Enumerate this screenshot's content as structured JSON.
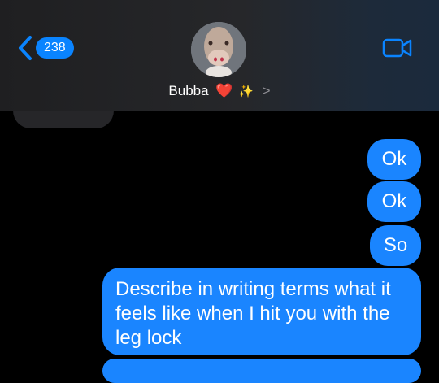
{
  "header": {
    "unread_count": "238",
    "contact_name": "Bubba",
    "heart_emoji": "❤️",
    "sparkle_emoji": "✨",
    "chevron": ">"
  },
  "messages": {
    "received_partial": "WE DO",
    "sent": [
      "Ok",
      "Ok",
      "So",
      "Describe in writing terms what it feels like when I hit you with the leg lock"
    ]
  },
  "colors": {
    "sent_bubble": "#1a85ff",
    "received_bubble": "#262629",
    "accent": "#0a84ff",
    "background": "#000000"
  }
}
